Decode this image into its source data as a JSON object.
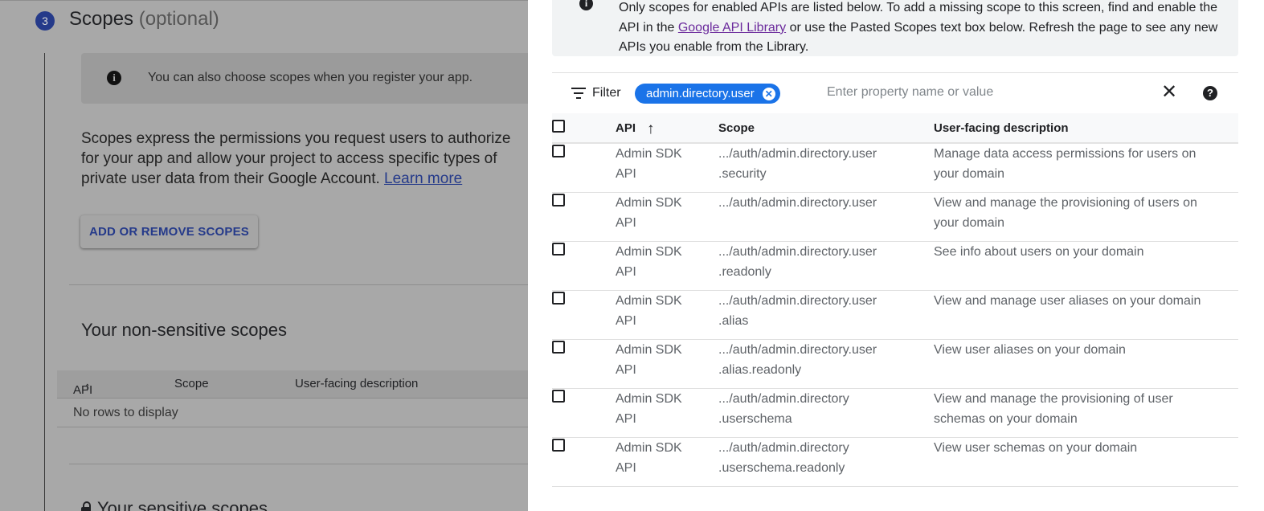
{
  "background": {
    "step_number": "3",
    "step_title": "Scopes",
    "step_optional": "(optional)",
    "info_text": "You can also choose scopes when you register your app.",
    "description": "Scopes express the permissions you request users to authorize for your app and allow your project to access specific types of private user data from their Google Account.",
    "learn_more": "Learn more",
    "add_remove_button": "ADD OR REMOVE SCOPES",
    "non_sensitive_title": "Your non-sensitive scopes",
    "table_headers": {
      "api": "API",
      "scope": "Scope",
      "description": "User-facing description"
    },
    "no_rows": "No rows to display",
    "sensitive_title": "Your sensitive scopes"
  },
  "panel": {
    "notice": {
      "line_prefix": "Only scopes for enabled APIs are listed below. To add a missing scope to this screen, find and enable the API in the",
      "library_link": "Google API Library",
      "line_suffix": "or use the Pasted Scopes text box below. Refresh the page to see any new APIs you enable from the Library."
    },
    "filter": {
      "label": "Filter",
      "chip": "admin.directory.user",
      "placeholder": "Enter property name or value"
    },
    "table": {
      "headers": {
        "api": "API",
        "scope": "Scope",
        "description": "User-facing description"
      },
      "rows": [
        {
          "api": "Admin SDK API",
          "scope_l1": ".../auth/admin.directory.user",
          "scope_l2": ".security",
          "description": "Manage data access permissions for users on your domain"
        },
        {
          "api": "Admin SDK API",
          "scope_l1": ".../auth/admin.directory.user",
          "scope_l2": "",
          "description": "View and manage the provisioning of users on your domain"
        },
        {
          "api": "Admin SDK API",
          "scope_l1": ".../auth/admin.directory.user",
          "scope_l2": ".readonly",
          "description": "See info about users on your domain"
        },
        {
          "api": "Admin SDK API",
          "scope_l1": ".../auth/admin.directory.user",
          "scope_l2": ".alias",
          "description": "View and manage user aliases on your domain"
        },
        {
          "api": "Admin SDK API",
          "scope_l1": ".../auth/admin.directory.user",
          "scope_l2": ".alias.readonly",
          "description": "View user aliases on your domain"
        },
        {
          "api": "Admin SDK API",
          "scope_l1": ".../auth/admin.directory",
          "scope_l2": ".userschema",
          "description": "View and manage the provisioning of user schemas on your domain"
        },
        {
          "api": "Admin SDK API",
          "scope_l1": ".../auth/admin.directory",
          "scope_l2": ".userschema.readonly",
          "description": "View user schemas on your domain"
        }
      ]
    }
  }
}
